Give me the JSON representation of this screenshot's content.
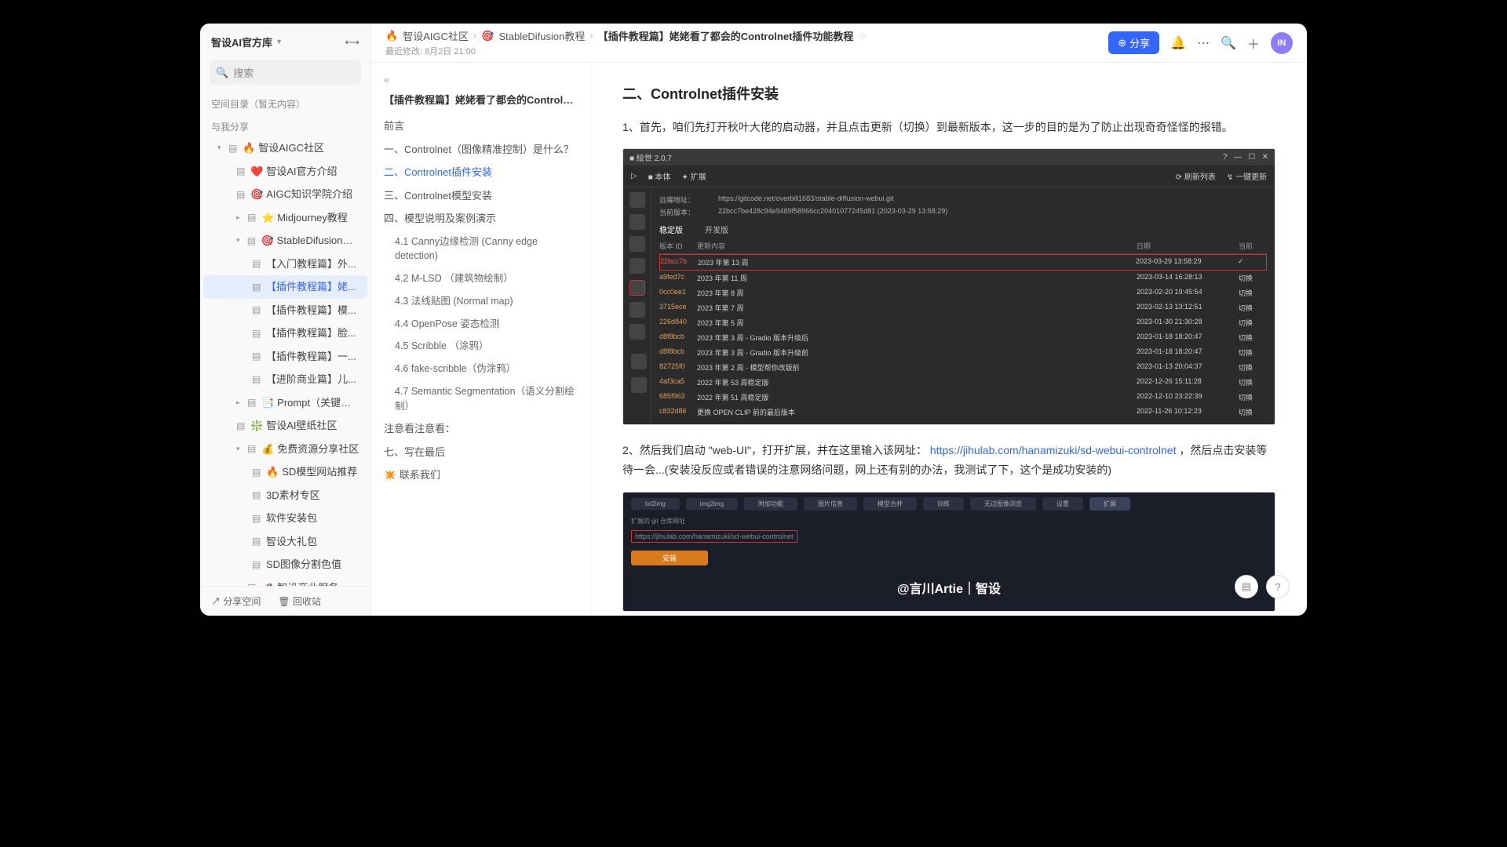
{
  "brand": "智设AI官方库",
  "search_placeholder": "搜索",
  "space_toc": "空间目录（暂无内容）",
  "shared_with_me": "与我分享",
  "tree": {
    "aigc_community": "智设AIGC社区",
    "intro": "智设AI官方介绍",
    "knowledge": "AIGC知识学院介绍",
    "mj": "Midjourney教程",
    "sd": "StableDifusion教程",
    "intro_tut": "【入门教程篇】外...",
    "plugin_cur": "【插件教程篇】姥...",
    "plugin_model": "【插件教程篇】模...",
    "plugin_face": "【插件教程篇】脸...",
    "plugin_one": "【插件教程篇】一...",
    "advanced": "【进阶商业篇】儿...",
    "prompt": "Prompt（关键词）",
    "wallpaper": "智设AI壁纸社区",
    "free_res": "免费资源分享社区",
    "sd_model": "SD模型网站推荐",
    "model3d": "3D素材专区",
    "software": "软件安装包",
    "gift": "智设大礼包",
    "sd_seg": "SD图像分割色值",
    "business": "智设商业服务"
  },
  "foot": {
    "share_space": "分享空间",
    "recycle": "回收站"
  },
  "crumbs": {
    "a": "智设AIGC社区",
    "b": "StableDifusion教程",
    "c": "【插件教程篇】姥姥看了都会的Controlnet插件功能教程"
  },
  "last_modified": "最近修改: 8月2日 21:00",
  "share_label": "分享",
  "outline": {
    "title": "【插件教程篇】姥姥看了都会的Controlnet插...",
    "items": [
      "前言",
      "一、Controlnet（图像精准控制）是什么？",
      "二、Controlnet插件安装",
      "三、Controlnet模型安装",
      "四、模型说明及案例演示",
      "注意看注意看：",
      "七、写在最后"
    ],
    "subs": [
      "4.1 Canny边缘检测 (Canny edge detection)",
      "4.2 M-LSD （建筑物绘制）",
      "4.3 法线贴图 (Normal map)",
      "4.4 OpenPose 姿态检测",
      "4.5 Scribble （涂鸦）",
      "4.6 fake-scribble（伪涂鸦）",
      "4.7 Semantic Segmentation（语义分割绘制）"
    ],
    "contact": "联系我们"
  },
  "content": {
    "h2": "二、Controlnet插件安装",
    "p1": "1、首先，咱们先打开秋叶大佬的启动器，并且点击更新（切换）到最新版本，这一步的目的是为了防止出现奇奇怪怪的报错。",
    "p2_pre": "2、然后我们启动 \"web-UI\"，打开扩展，并在这里输入该网址：",
    "p2_link": "https://jihulab.com/hanamizuki/sd-webui-controlnet",
    "p2_post": " ，然后点击安装等待一会...(安装没反应或者错误的注意网络问题，网上还有别的办法，我测试了下，这个是成功安装的)"
  },
  "app": {
    "title": "绘世 2.0.7",
    "tb_left": [
      "▷",
      "本体",
      "扩展"
    ],
    "tb_right": [
      "刷新列表",
      "一键更新"
    ],
    "remote_label": "远端地址：",
    "remote": "https://gitcode.net/overbill1683/stable-diffusion-webui.git",
    "local_label": "当前版本：",
    "local": "22bcc7be428c94e9489f58966cc20401077245d81 (2023-03-29 13:58:29)",
    "tab_stable": "稳定版",
    "tab_dev": "开发版",
    "th": [
      "版本 ID",
      "更新内容",
      "日期",
      "当前"
    ],
    "rows": [
      {
        "id": "22bcc7b",
        "desc": "2023 年第 13 周",
        "date": "2023-03-29 13:58:29",
        "cur": "✓"
      },
      {
        "id": "a9fed7c",
        "desc": "2023 年第 11 周",
        "date": "2023-03-14 16:28:13",
        "cur": "切换"
      },
      {
        "id": "0cc0ee1",
        "desc": "2023 年第 8 周",
        "date": "2023-02-20 19:45:54",
        "cur": "切换"
      },
      {
        "id": "3715ece",
        "desc": "2023 年第 7 周",
        "date": "2023-02-13 13:12:51",
        "cur": "切换"
      },
      {
        "id": "226d840",
        "desc": "2023 年第 5 周",
        "date": "2023-01-30 21:30:28",
        "cur": "切换"
      },
      {
        "id": "d8f8bcb",
        "desc": "2023 年第 3 周 - Gradio 版本升级后",
        "date": "2023-01-18 18:20:47",
        "cur": "切换"
      },
      {
        "id": "d8f8bcb",
        "desc": "2023 年第 3 周 - Gradio 版本升级前",
        "date": "2023-01-18 18:20:47",
        "cur": "切换"
      },
      {
        "id": "82725f0",
        "desc": "2023 年第 2 周 - 模型帮你改版前",
        "date": "2023-01-13 20:04:37",
        "cur": "切换"
      },
      {
        "id": "4af3ca5",
        "desc": "2022 年第 53 周稳定版",
        "date": "2022-12-26 15:11:28",
        "cur": "切换"
      },
      {
        "id": "685f963",
        "desc": "2022 年第 51 周稳定版",
        "date": "2022-12-10 23:22:39",
        "cur": "切换"
      },
      {
        "id": "c832d86",
        "desc": "更换 OPEN CLIP 前的最后版本",
        "date": "2022-11-26 10:12:23",
        "cur": "切换"
      }
    ]
  },
  "img2": {
    "url_label": "扩展的 git 仓库网址",
    "url_val": "https://jihulab.com/hanamizuki/sd-webui-controlnet",
    "install": "安装",
    "watermark": "@言川Artie｜智设"
  }
}
